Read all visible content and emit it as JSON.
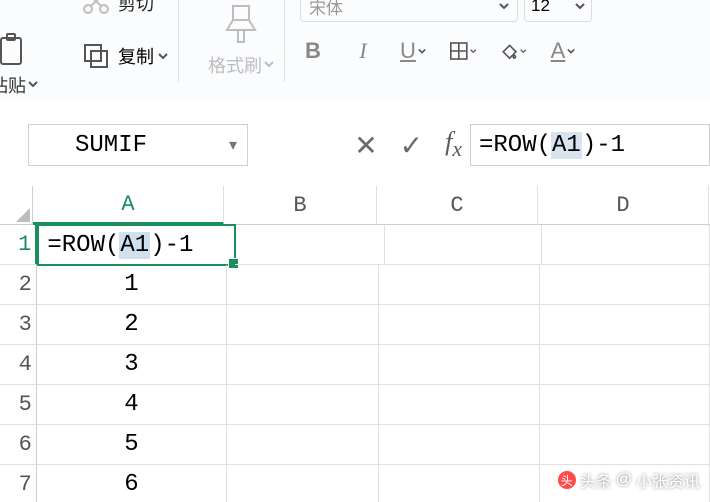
{
  "toolbar": {
    "cut_label": "剪切",
    "paste_label": "粘贴",
    "copy_label": "复制",
    "format_painter_label": "格式刷",
    "font_name": "宋体",
    "font_size": "12"
  },
  "formula_bar": {
    "name_box": "SUMIF",
    "formula_prefix": "=ROW(",
    "formula_ref": "A1",
    "formula_suffix": ")-1"
  },
  "sheet": {
    "columns": [
      "A",
      "B",
      "C",
      "D"
    ],
    "rows": [
      {
        "n": "1",
        "a_prefix": "=ROW(",
        "a_ref": "A1",
        "a_suffix": ")-1",
        "editing": true
      },
      {
        "n": "2",
        "a": "1"
      },
      {
        "n": "3",
        "a": "2"
      },
      {
        "n": "4",
        "a": "3"
      },
      {
        "n": "5",
        "a": "4"
      },
      {
        "n": "6",
        "a": "5"
      },
      {
        "n": "7",
        "a": "6"
      }
    ]
  },
  "watermark": {
    "prefix": "头条",
    "at": "@",
    "name": "小张资讯"
  }
}
